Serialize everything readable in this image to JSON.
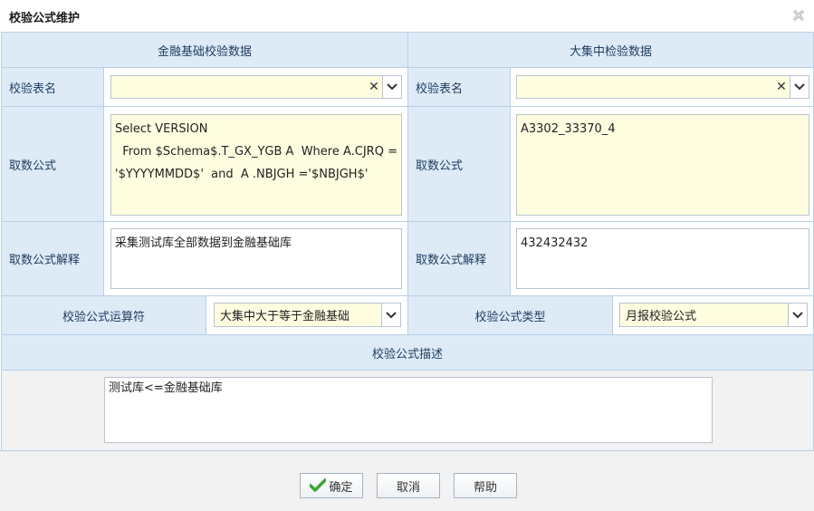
{
  "dialog": {
    "title": "校验公式维护"
  },
  "headers": {
    "left": "金融基础校验数据",
    "right": "大集中检验数据"
  },
  "left": {
    "table_label": "校验表名",
    "table_value": "",
    "formula_label": "取数公式",
    "formula_value": "Select VERSION\n  From $Schema$.T_GX_YGB A  Where A.CJRQ = '$YYYYMMDD$'  and  A .NBJGH ='$NBJGH$'",
    "explain_label": "取数公式解释",
    "explain_value": "采集测试库全部数据到金融基础库"
  },
  "right": {
    "table_label": "校验表名",
    "table_value": "",
    "formula_label": "取数公式",
    "formula_value": "A3302_33370_4",
    "explain_label": "取数公式解释",
    "explain_value": "432432432"
  },
  "operator": {
    "label": "校验公式运算符",
    "value": "大集中大于等于金融基础"
  },
  "type": {
    "label": "校验公式类型",
    "value": "月报校验公式"
  },
  "description": {
    "header": "校验公式描述",
    "value": "测试库<=金融基础库"
  },
  "buttons": {
    "ok": "确定",
    "cancel": "取消",
    "help": "帮助"
  },
  "colors": {
    "panel": "#deebf7",
    "field": "#fffde0",
    "border": "#b8cfe6"
  }
}
